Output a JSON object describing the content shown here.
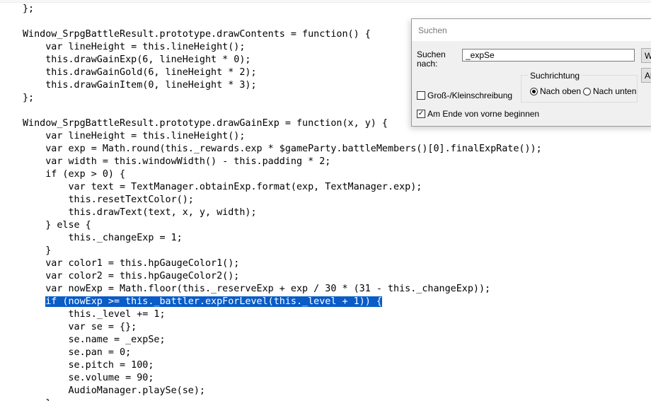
{
  "editor": {
    "lines": [
      "};",
      "",
      "Window_SrpgBattleResult.prototype.drawContents = function() {",
      "    var lineHeight = this.lineHeight();",
      "    this.drawGainExp(6, lineHeight * 0);",
      "    this.drawGainGold(6, lineHeight * 2);",
      "    this.drawGainItem(0, lineHeight * 3);",
      "};",
      "",
      "Window_SrpgBattleResult.prototype.drawGainExp = function(x, y) {",
      "    var lineHeight = this.lineHeight();",
      "    var exp = Math.round(this._rewards.exp * $gameParty.battleMembers()[0].finalExpRate());",
      "    var width = this.windowWidth() - this.padding * 2;",
      "    if (exp > 0) {",
      "        var text = TextManager.obtainExp.format(exp, TextManager.exp);",
      "        this.resetTextColor();",
      "        this.drawText(text, x, y, width);",
      "    } else {",
      "        this._changeExp = 1;",
      "    }",
      "    var color1 = this.hpGaugeColor1();",
      "    var color2 = this.hpGaugeColor2();",
      "    var nowExp = Math.floor(this._reserveExp + exp / 30 * (31 - this._changeExp));",
      "    if (nowExp >= this._battler.expForLevel(this._level + 1)) {",
      "        this._level += 1;",
      "        var se = {};",
      "        se.name = _expSe;",
      "        se.pan = 0;",
      "        se.pitch = 100;",
      "        se.volume = 90;",
      "        AudioManager.playSe(se);",
      "    }"
    ],
    "highlight": {
      "line_index": 23,
      "indent": "    ",
      "text": "if (nowExp >= this._battler.expForLevel(this._level + 1)) {"
    },
    "highlight_color": "#0a5cc7"
  },
  "find_dialog": {
    "title": "Suchen",
    "find_label": "Suchen nach:",
    "find_value": "_expSe",
    "next_button_label": "Weitersuchen",
    "cancel_button_label": "Abbrechen",
    "direction_label": "Suchrichtung",
    "direction_up_label": "Nach oben",
    "direction_down_label": "Nach unten",
    "direction_selected": "up",
    "match_case_label": "Groß-/Kleinschreibung",
    "match_case_checked": false,
    "wrap_label": "Am Ende von vorne beginnen",
    "wrap_checked": true
  }
}
